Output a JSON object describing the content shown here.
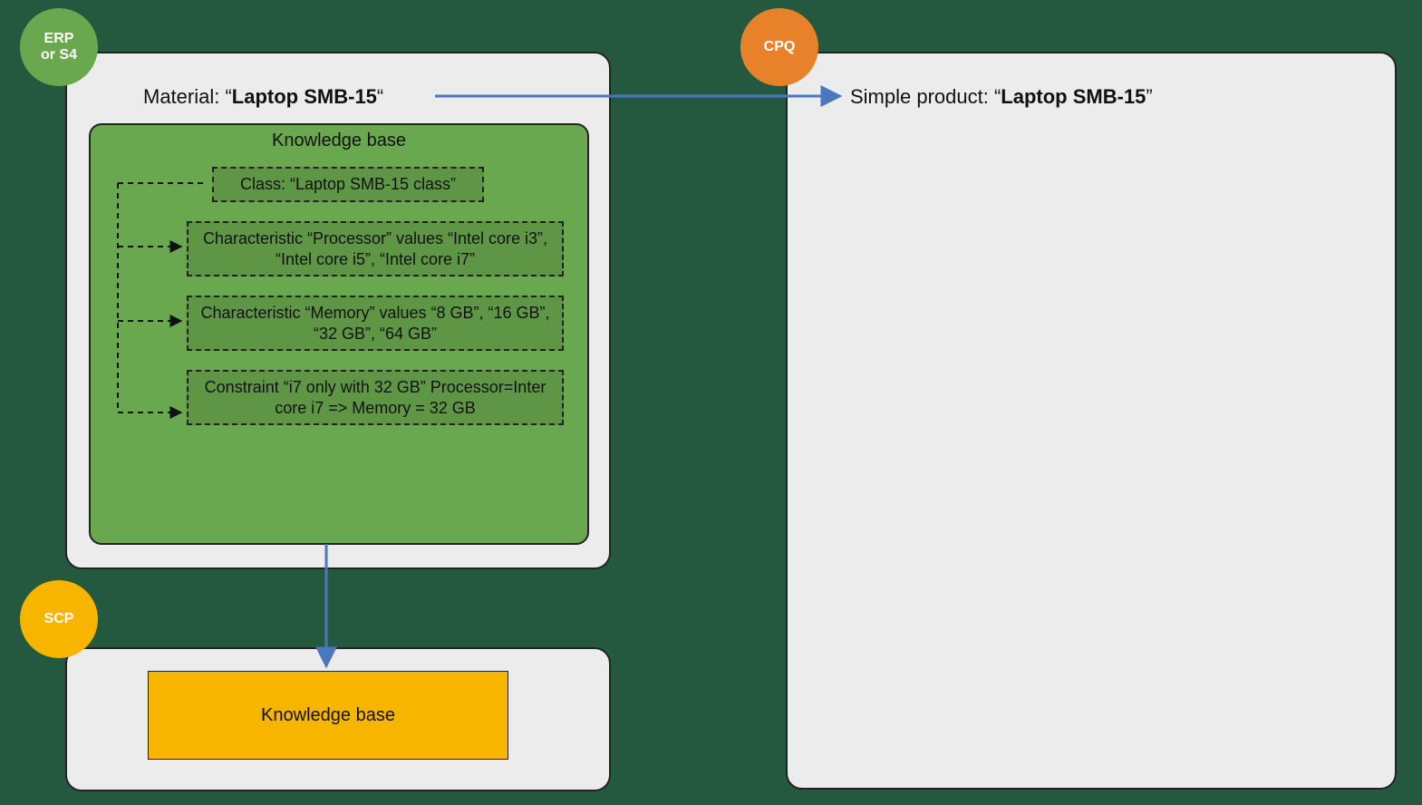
{
  "erp": {
    "badge": "ERP\nor S4",
    "material_prefix": "Material: “",
    "material_name": "Laptop SMB-15",
    "material_suffix": "“",
    "kb_title": "Knowledge base",
    "class_box": "Class: “Laptop SMB-15 class”",
    "char_processor": "Characteristic “Processor” values “Intel core i3”, “Intel core i5”, “Intel core i7”",
    "char_memory": "Characteristic “Memory” values “8 GB”, “16 GB”, “32 GB”, “64 GB”",
    "constraint": "Constraint “i7 only with 32 GB” Processor=Inter core i7 => Memory = 32 GB"
  },
  "cpq": {
    "badge": "CPQ",
    "product_prefix": "Simple product: “",
    "product_name": "Laptop SMB-15",
    "product_suffix": "”"
  },
  "scp": {
    "badge": "SCP",
    "kb_label": "Knowledge base"
  }
}
